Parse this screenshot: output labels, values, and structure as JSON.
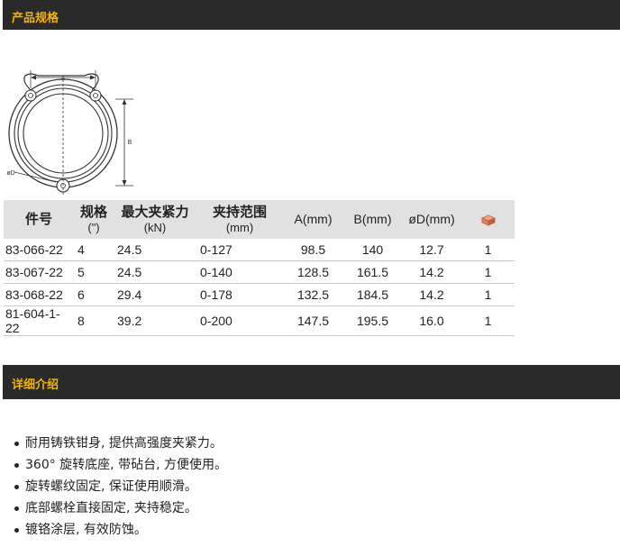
{
  "sections": {
    "spec_title": "产品规格",
    "detail_title": "详细介绍"
  },
  "diagram": {
    "label_a": "A",
    "label_b": "B",
    "label_d": "øD"
  },
  "table": {
    "headers": {
      "part_no": "件号",
      "size_main": "规格",
      "size_sub": "(\")",
      "force_main": "最大夹紧力",
      "force_sub": "(kN)",
      "range_main": "夹持范围",
      "range_sub": "(mm)",
      "a": "A(mm)",
      "b": "B(mm)",
      "d": "øD(mm)",
      "pack_icon": "box-icon"
    },
    "rows": [
      {
        "part_no": "83-066-22",
        "size": "4",
        "force": "24.5",
        "range": "0-127",
        "a": "98.5",
        "b": "140",
        "d": "12.7",
        "qty": "1"
      },
      {
        "part_no": "83-067-22",
        "size": "5",
        "force": "24.5",
        "range": "0-140",
        "a": "128.5",
        "b": "161.5",
        "d": "14.2",
        "qty": "1"
      },
      {
        "part_no": "83-068-22",
        "size": "6",
        "force": "29.4",
        "range": "0-178",
        "a": "132.5",
        "b": "184.5",
        "d": "14.2",
        "qty": "1"
      },
      {
        "part_no": "81-604-1-22",
        "size": "8",
        "force": "39.2",
        "range": "0-200",
        "a": "147.5",
        "b": "195.5",
        "d": "16.0",
        "qty": "1"
      }
    ]
  },
  "details": [
    "耐用铸铁钳身, 提供高强度夹紧力。",
    "360° 旋转底座, 带砧台, 方便使用。",
    "旋转螺纹固定, 保证使用顺滑。",
    "底部螺栓直接固定, 夹持稳定。",
    "镀铬涂层, 有效防蚀。"
  ],
  "colors": {
    "bar_bg": "#2a2a2a",
    "bar_text": "#f4b400",
    "header_bg": "#e1e1e1",
    "icon_copper": "#d9825b"
  }
}
